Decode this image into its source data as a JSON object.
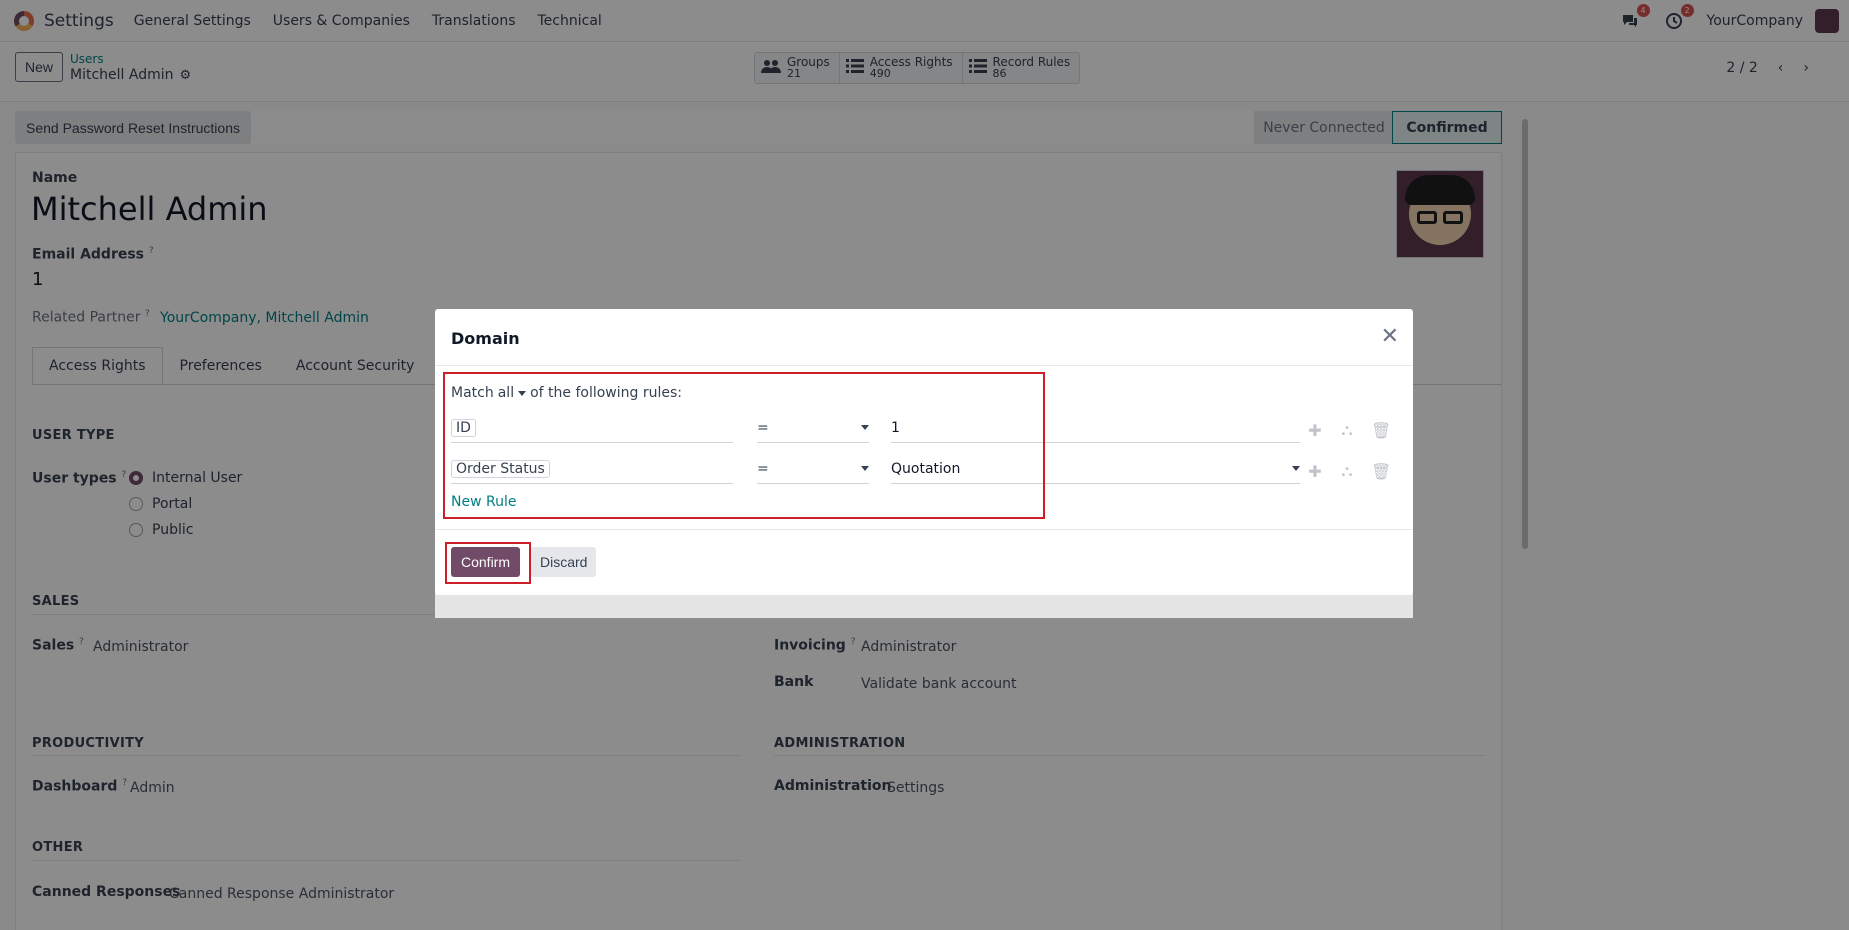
{
  "topnav": {
    "app_title": "Settings",
    "menu": [
      "General Settings",
      "Users & Companies",
      "Translations",
      "Technical"
    ],
    "messages_badge": "4",
    "activities_badge": "2",
    "company": "YourCompany"
  },
  "control_panel": {
    "new_label": "New",
    "breadcrumb_parent": "Users",
    "breadcrumb_current": "Mitchell Admin",
    "stats": [
      {
        "label": "Groups",
        "value": "21"
      },
      {
        "label": "Access Rights",
        "value": "490"
      },
      {
        "label": "Record Rules",
        "value": "86"
      }
    ],
    "pager": "2 / 2"
  },
  "form": {
    "reset_button": "Send Password Reset Instructions",
    "stages": [
      "Never Connected",
      "Confirmed"
    ],
    "name_label": "Name",
    "name_value": "Mitchell Admin",
    "email_label": "Email Address",
    "email_value": "1",
    "partner_label": "Related Partner",
    "partner_value": "YourCompany, Mitchell Admin",
    "tabs": [
      "Access Rights",
      "Preferences",
      "Account Security"
    ],
    "user_type_section": "USER TYPE",
    "user_types_label": "User types",
    "user_types": [
      "Internal User",
      "Portal",
      "Public"
    ],
    "sales_section": "SALES",
    "sales_label": "Sales",
    "sales_value": "Administrator",
    "invoicing_label": "Invoicing",
    "invoicing_value": "Administrator",
    "bank_label": "Bank",
    "bank_value": "Validate bank account",
    "productivity_section": "PRODUCTIVITY",
    "dashboard_label": "Dashboard",
    "dashboard_value": "Admin",
    "administration_section": "ADMINISTRATION",
    "administration_label": "Administration",
    "administration_value": "Settings",
    "other_section": "OTHER",
    "canned_label": "Canned Responses",
    "canned_value": "Canned Response Administrator",
    "tooltip_mark": "?"
  },
  "dialog": {
    "title": "Domain",
    "match_prefix": "Match",
    "match_value": "all",
    "match_suffix": "of the following rules:",
    "rules": [
      {
        "path": "ID",
        "operator": "=",
        "value": "1"
      },
      {
        "path": "Order Status",
        "operator": "=",
        "value": "Quotation"
      }
    ],
    "new_rule": "New Rule",
    "confirm": "Confirm",
    "discard": "Discard"
  },
  "colors": {
    "brand": "#714b67",
    "link": "#017e84",
    "highlight": "#cc1f2a"
  }
}
